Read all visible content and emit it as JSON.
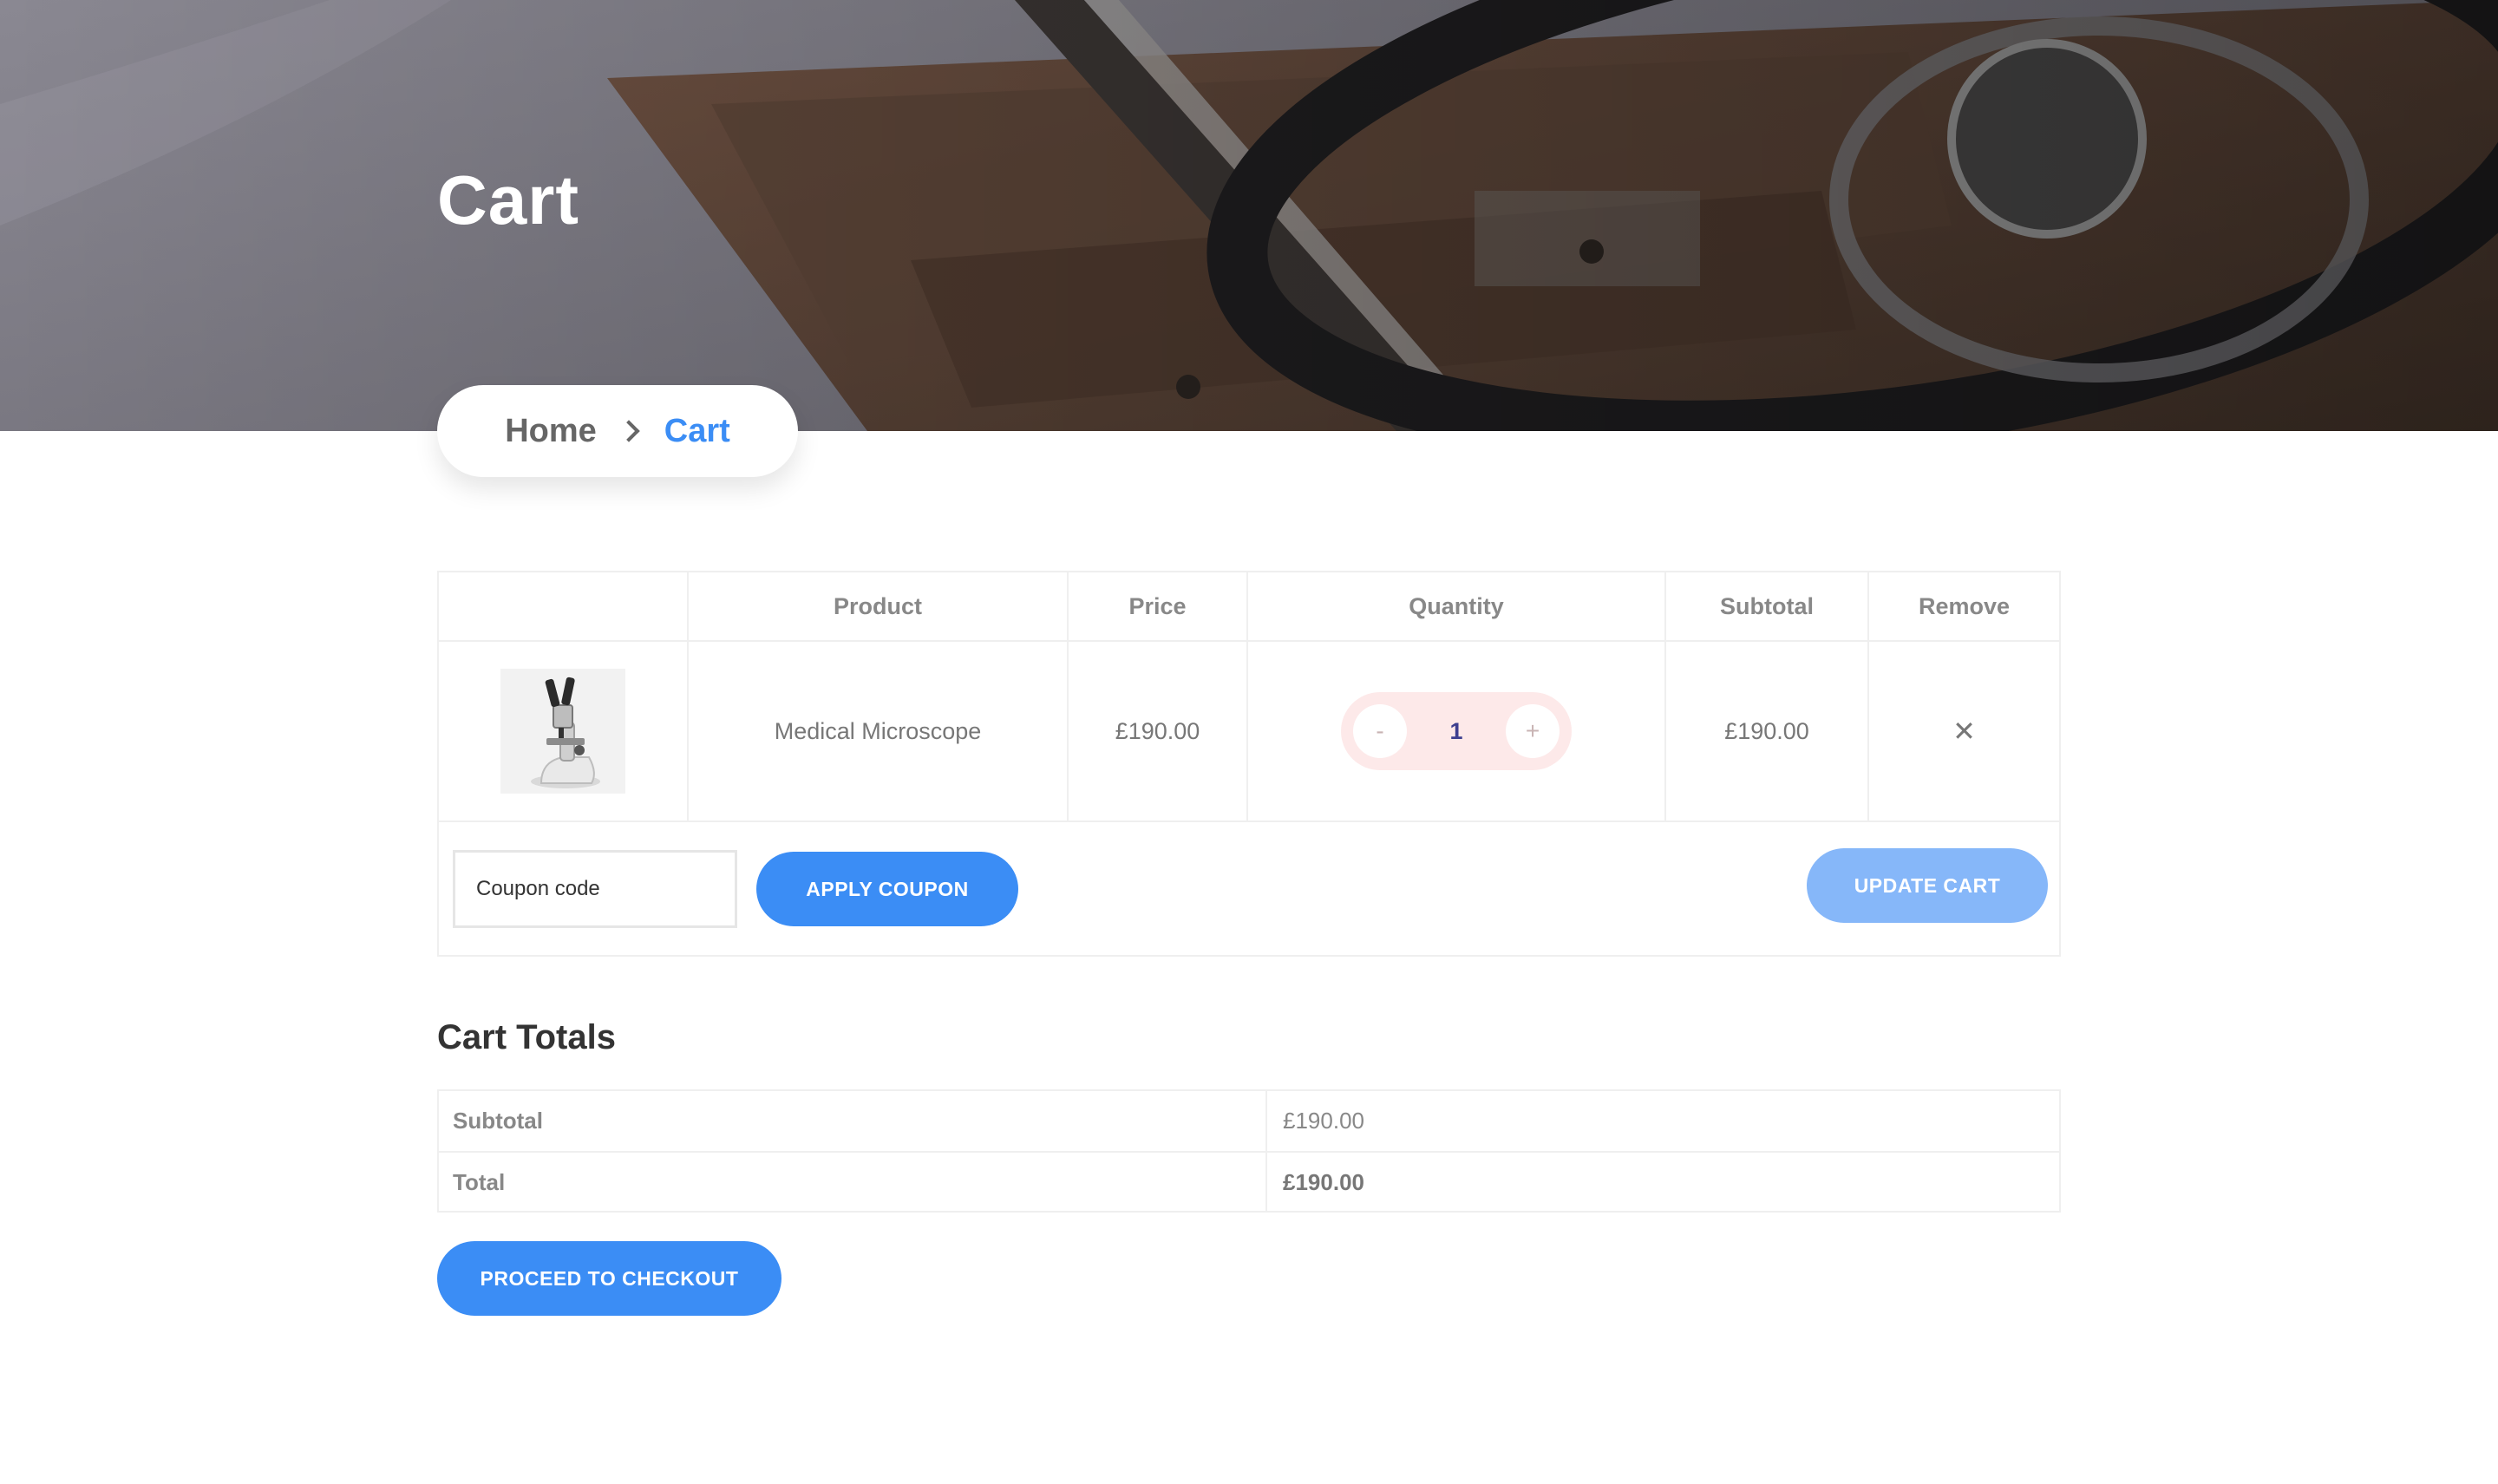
{
  "hero": {
    "title": "Cart"
  },
  "breadcrumb": {
    "home": "Home",
    "current": "Cart"
  },
  "cart": {
    "headers": [
      "",
      "Product",
      "Price",
      "Quantity",
      "Subtotal",
      "Remove"
    ],
    "items": [
      {
        "product": "Medical Microscope",
        "price": "£190.00",
        "quantity": "1",
        "subtotal": "£190.00",
        "remove": "✕"
      }
    ],
    "qty_minus": "-",
    "qty_plus": "+",
    "coupon_placeholder": "Coupon code",
    "apply_coupon_label": "APPLY COUPON",
    "update_cart_label": "UPDATE CART"
  },
  "totals": {
    "title": "Cart Totals",
    "subtotal_label": "Subtotal",
    "subtotal_value": "£190.00",
    "total_label": "Total",
    "total_value": "£190.00",
    "checkout_label": "PROCEED TO CHECKOUT"
  },
  "colors": {
    "accent": "#3b8df5",
    "accent_light": "#86b7f9",
    "qty_bg": "#fde9e9"
  },
  "icons": {
    "breadcrumb_separator": "chevron-right-icon",
    "remove": "close-icon",
    "product_image": "microscope-image"
  }
}
